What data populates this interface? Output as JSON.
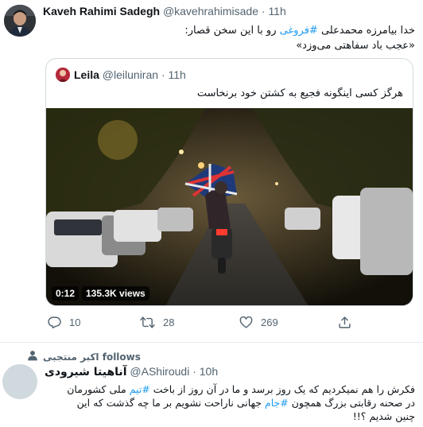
{
  "tweet": {
    "author_name": "Kaveh Rahimi Sadegh",
    "author_handle": "@kavehrahimisade",
    "separator": "·",
    "time": "11h",
    "text_line1_before": "خدا بیامرزه محمدعلی ",
    "text_line1_hashtag": "#فروغی",
    "text_line1_after": " رو با این سخن قصار:",
    "text_line2": "«عجب باد سفاهتی می‌وزد»"
  },
  "quoted": {
    "author_name": "Leila",
    "author_handle": "@leiluniran",
    "separator": "·",
    "time": "11h",
    "text": "هرگز کسی اینگونه فجیع به کشتن خود برنخاست",
    "video_time": "0:12",
    "video_views": "135.3K views"
  },
  "actions": {
    "replies": "10",
    "retweets": "28",
    "likes": "269"
  },
  "reply": {
    "follows_text": "اکبر منتجبی follows",
    "author_name": "آناهیتا شیرودی",
    "author_handle": "@AShiroudi",
    "separator": "·",
    "time": "10h",
    "line1_before": "فکرش را هم نمیکردیم که یک روز برسد و ما در آن روز از باخت ",
    "line1_hashtag": "#تیم",
    "line1_after": " ملی کشورمان",
    "line2_before": "در صحنه رقابتی بزرگ همچون ",
    "line2_hashtag": "#جام",
    "line2_after": " جهانی ناراحت نشویم بر ما چه گذشت که این",
    "line3": "چنین شدیم ؟!!"
  },
  "colors": {
    "accent": "#1d9bf0",
    "secondary_text": "#536471",
    "border": "#cfd9de"
  },
  "icons": [
    "reply-icon",
    "retweet-icon",
    "like-icon",
    "share-icon",
    "follows-person-icon"
  ]
}
